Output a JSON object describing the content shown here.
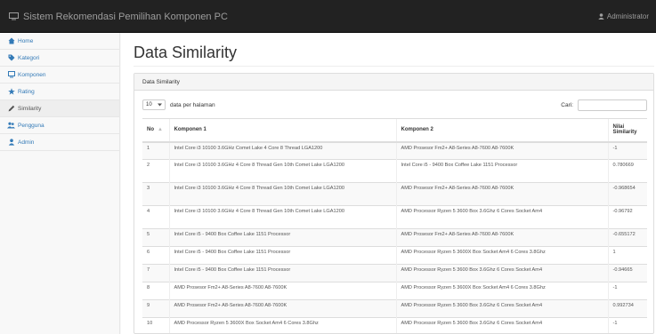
{
  "app": {
    "title": "Sistem Rekomendasi Pemilihan Komponen PC",
    "user": "Administrator"
  },
  "sidebar": {
    "items": [
      {
        "label": "Home",
        "icon": "home-icon"
      },
      {
        "label": "Kategori",
        "icon": "tag-icon"
      },
      {
        "label": "Komponen",
        "icon": "monitor-icon"
      },
      {
        "label": "Rating",
        "icon": "star-icon"
      },
      {
        "label": "Similarity",
        "icon": "pencil-icon"
      },
      {
        "label": "Pengguna",
        "icon": "users-icon"
      },
      {
        "label": "Admin",
        "icon": "user-icon"
      }
    ],
    "active_index": 4
  },
  "page": {
    "title": "Data Similarity"
  },
  "panel": {
    "heading": "Data Similarity"
  },
  "controls": {
    "length_value": "10",
    "length_suffix": "data per halaman",
    "search_label": "Cari:",
    "search_value": ""
  },
  "table": {
    "headers": {
      "no": "No",
      "komponen1": "Komponen 1",
      "komponen2": "Komponen 2",
      "nilai_line1": "Nilai",
      "nilai_line2": "Similarity"
    },
    "rows": [
      {
        "no": "1",
        "k1": "Intel Core i3 10100 3.6GHz Comet Lake 4 Core 8 Thread LGA1200",
        "k2": "AMD Prosesor Fm2+ A8-Series A8-7600 A8-7600K",
        "sim": "-1"
      },
      {
        "no": "2",
        "k1": "Intel Core i3 10100 3.6GHz 4 Core 8 Thread Gen 10th Comet Lake LGA1200",
        "k2": "Intel Core i5 - 9400 Box Coffee Lake 1151 Processor",
        "sim": "0.780669"
      },
      {
        "no": "3",
        "k1": "Intel Core i3 10100 3.6GHz 4 Core 8 Thread Gen 10th Comet Lake LGA1200",
        "k2": "AMD Prosesor Fm2+ A8-Series A8-7600 A8-7600K",
        "sim": "-0.968654"
      },
      {
        "no": "4",
        "k1": "Intel Core i3 10100 3.6GHz 4 Core 8 Thread Gen 10th Comet Lake LGA1200",
        "k2": "AMD Processor Ryzen 5 3600 Box 3.6Ghz 6 Cores Socket Am4",
        "sim": "-0.96792"
      },
      {
        "no": "5",
        "k1": "Intel Core i5 - 9400 Box Coffee Lake 1151 Processor",
        "k2": "AMD Prosesor Fm2+ A8-Series A8-7600 A8-7600K",
        "sim": "-0.655172"
      },
      {
        "no": "6",
        "k1": "Intel Core i5 - 9400 Box Coffee Lake 1151 Processor",
        "k2": "AMD Processor Ryzen 5 3600X Box Socket Am4 6 Cores 3.8Ghz",
        "sim": "1"
      },
      {
        "no": "7",
        "k1": "Intel Core i5 - 9400 Box Coffee Lake 1151 Processor",
        "k2": "AMD Processor Ryzen 5 3600 Box 3.6Ghz 6 Cores Socket Am4",
        "sim": "-0.94665"
      },
      {
        "no": "8",
        "k1": "AMD Prosesor Fm2+ A8-Series A8-7600 A8-7600K",
        "k2": "AMD Processor Ryzen 5 3600X Box Socket Am4 6 Cores 3.8Ghz",
        "sim": "-1"
      },
      {
        "no": "9",
        "k1": "AMD Prosesor Fm2+ A8-Series A8-7600 A8-7600K",
        "k2": "AMD Processor Ryzen 5 3600 Box 3.6Ghz 6 Cores Socket Am4",
        "sim": "0.992734"
      },
      {
        "no": "10",
        "k1": "AMD Processor Ryzen 5 3600X Box Socket Am4 6 Cores 3.8Ghz",
        "k2": "AMD Processor Ryzen 5 3600 Box 3.6Ghz 6 Cores Socket Am4",
        "sim": "-1"
      }
    ]
  },
  "colors": {
    "navbar": "#222222",
    "link": "#337ab7",
    "active_bg": "#eeeeee"
  }
}
